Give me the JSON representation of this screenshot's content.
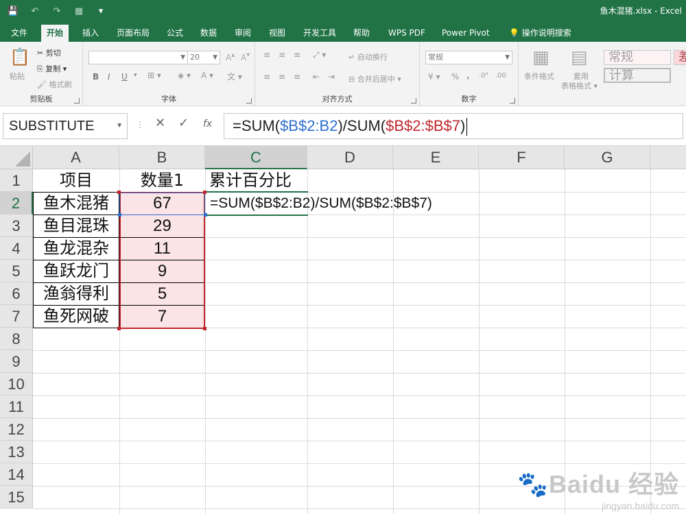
{
  "window": {
    "title": "鱼木混猪.xlsx  -  Excel"
  },
  "qat": {
    "save_icon": "💾",
    "undo_icon": "↶",
    "redo_icon": "↷",
    "form_icon": "▦",
    "more_icon": "▾"
  },
  "tabs": [
    "文件",
    "开始",
    "插入",
    "页面布局",
    "公式",
    "数据",
    "审阅",
    "视图",
    "开发工具",
    "帮助",
    "WPS PDF",
    "Power Pivot",
    "操作说明搜索"
  ],
  "ribbon": {
    "clipboard": {
      "paste": "粘贴",
      "cut": "剪切",
      "copy": "复制",
      "format_painter": "格式刷",
      "label": "剪贴板"
    },
    "font": {
      "font_name": "",
      "font_size": "20",
      "bold": "B",
      "italic": "I",
      "underline": "U",
      "label": "字体",
      "font_color_letter": "A"
    },
    "alignment": {
      "wrap": "自动换行",
      "merge": "合并后居中",
      "label": "对齐方式"
    },
    "number": {
      "format": "常规",
      "percent": "%",
      "comma": ",",
      "label": "数字"
    },
    "styles": {
      "conditional": "条件格式",
      "table": "套用",
      "table2": "表格格式",
      "normal": "常规",
      "calc": "计算",
      "other": "差"
    }
  },
  "formula_bar": {
    "name_box": "SUBSTITUTE",
    "cancel": "✕",
    "enter": "✓",
    "fx": "fx",
    "parts": {
      "p1": "=SUM(",
      "p2": "$B$2:B2",
      "p3": ")/SUM(",
      "p4": "$B$2:$B$7",
      "p5": ")"
    }
  },
  "grid": {
    "columns": [
      "A",
      "B",
      "C",
      "D",
      "E",
      "F",
      "G"
    ],
    "rows": [
      "1",
      "2",
      "3",
      "4",
      "5",
      "6",
      "7",
      "8",
      "9",
      "10",
      "11",
      "12",
      "13",
      "14",
      "15"
    ],
    "header_row": {
      "a": "项目",
      "b": "数量1",
      "c": "累计百分比"
    },
    "data": [
      {
        "a": "鱼木混猪",
        "b": "67"
      },
      {
        "a": "鱼目混珠",
        "b": "29"
      },
      {
        "a": "鱼龙混杂",
        "b": "11"
      },
      {
        "a": "鱼跃龙门",
        "b": "9"
      },
      {
        "a": "渔翁得利",
        "b": "5"
      },
      {
        "a": "鱼死网破",
        "b": "7"
      }
    ],
    "c2_formula": "=SUM($B$2:B2)/SUM($B$2:$B$7)"
  },
  "watermark": {
    "brand": "Bai",
    "brand2": "经验",
    "url": "jingyan.baidu.com"
  },
  "colors": {
    "excel_green": "#217346",
    "ref_blue": "#2e6fd0",
    "ref_red": "#c0262d"
  }
}
